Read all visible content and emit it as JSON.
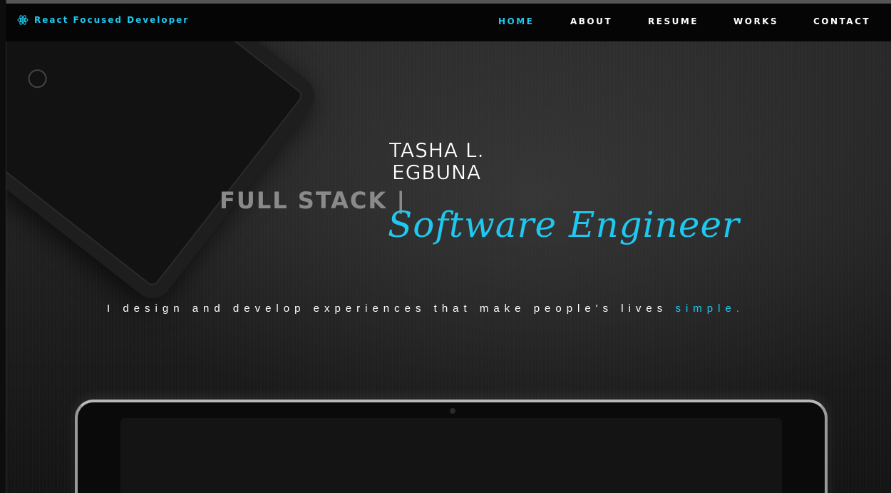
{
  "navbar": {
    "brand": "React Focused Developer",
    "brand_icon": "react-atom-icon",
    "items": [
      {
        "label": "HOME",
        "active": true
      },
      {
        "label": "ABOUT",
        "active": false
      },
      {
        "label": "RESUME",
        "active": false
      },
      {
        "label": "WORKS",
        "active": false
      },
      {
        "label": "CONTACT",
        "active": false
      }
    ]
  },
  "hero": {
    "name_line1": "TASHA L.",
    "name_line2": "EGBUNA",
    "prefix": "FULL STACK |",
    "role": "Software Engineer",
    "tagline_main": "I design and develop experiences that make people's lives",
    "tagline_accent": "simple."
  },
  "colors": {
    "accent": "#1fc8f0",
    "nav_bg": "#050505",
    "text": "#ffffff",
    "muted": "#8a8a8a"
  }
}
